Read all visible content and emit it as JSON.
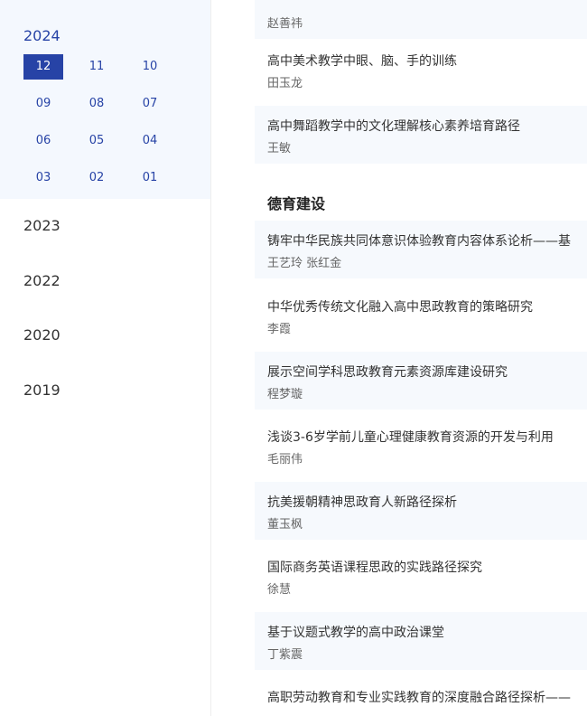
{
  "sidebar": {
    "active_year": "2024",
    "months": [
      "12",
      "11",
      "10",
      "09",
      "08",
      "07",
      "06",
      "05",
      "04",
      "03",
      "02",
      "01"
    ],
    "active_month": "12",
    "years": [
      "2023",
      "2022",
      "2020",
      "2019"
    ]
  },
  "main": {
    "top_articles": [
      {
        "title": "",
        "author": "赵善祎"
      },
      {
        "title": "高中美术教学中眼、脑、手的训练",
        "author": "田玉龙"
      },
      {
        "title": "高中舞蹈教学中的文化理解核心素养培育路径",
        "author": "王敏"
      }
    ],
    "section_title": "德育建设",
    "section_articles": [
      {
        "title": "铸牢中华民族共同体意识体验教育内容体系论析——基",
        "author": "王艺玲  张红金"
      },
      {
        "title": "中华优秀传统文化融入高中思政教育的策略研究",
        "author": "李霞"
      },
      {
        "title": "展示空间学科思政教育元素资源库建设研究",
        "author": "程梦璇"
      },
      {
        "title": "浅谈3-6岁学前儿童心理健康教育资源的开发与利用",
        "author": "毛丽伟"
      },
      {
        "title": "抗美援朝精神思政育人新路径探析",
        "author": "董玉枫"
      },
      {
        "title": "国际商务英语课程思政的实践路径探究",
        "author": "徐慧"
      },
      {
        "title": "基于议题式教学的高中政治课堂",
        "author": "丁紫震"
      },
      {
        "title": "高职劳动教育和专业实践教育的深度融合路径探析——",
        "author": ""
      }
    ]
  },
  "colors": {
    "accent": "#2743a6",
    "sidebar_active_bg": "#f4f8fe",
    "row_alt_bg": "#f6f9fd"
  }
}
